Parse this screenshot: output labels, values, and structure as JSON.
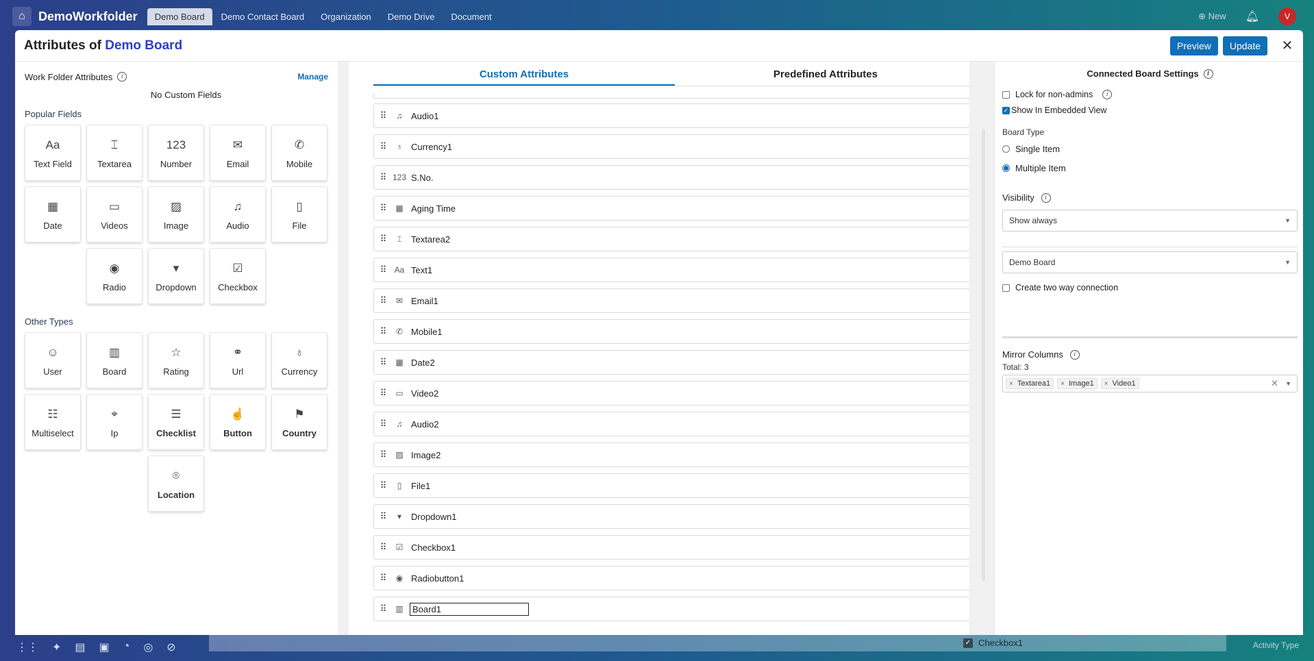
{
  "appbar": {
    "app_name": "DemoWorkfolder",
    "tabs": [
      "Demo Board",
      "Demo Contact Board",
      "Organization",
      "Demo Drive",
      "Document"
    ],
    "new_label": "New",
    "avatar": "V"
  },
  "modal": {
    "title_prefix": "Attributes of",
    "title_board": "Demo Board",
    "preview_label": "Preview",
    "update_label": "Update",
    "close_glyph": "✕"
  },
  "left": {
    "work_folder_title": "Work Folder Attributes",
    "manage_label": "Manage",
    "no_custom": "No Custom Fields",
    "popular_title": "Popular Fields",
    "popular": [
      {
        "label": "Text Field",
        "icon": "Aa"
      },
      {
        "label": "Textarea",
        "icon": "⌶"
      },
      {
        "label": "Number",
        "icon": "123"
      },
      {
        "label": "Email",
        "icon": "✉"
      },
      {
        "label": "Mobile",
        "icon": "✆"
      },
      {
        "label": "Date",
        "icon": "▦"
      },
      {
        "label": "Videos",
        "icon": "▭"
      },
      {
        "label": "Image",
        "icon": "▨"
      },
      {
        "label": "Audio",
        "icon": "♫"
      },
      {
        "label": "File",
        "icon": "▯"
      },
      {
        "label": "Radio",
        "icon": "◉"
      },
      {
        "label": "Dropdown",
        "icon": "▾"
      },
      {
        "label": "Checkbox",
        "icon": "☑"
      }
    ],
    "other_title": "Other Types",
    "other": [
      {
        "label": "User",
        "icon": "☺"
      },
      {
        "label": "Board",
        "icon": "▥"
      },
      {
        "label": "Rating",
        "icon": "☆"
      },
      {
        "label": "Url",
        "icon": "⚭"
      },
      {
        "label": "Currency",
        "icon": "♁"
      },
      {
        "label": "Multiselect",
        "icon": "☷"
      },
      {
        "label": "Ip",
        "icon": "⌖"
      },
      {
        "label": "Checklist",
        "icon": "☰"
      },
      {
        "label": "Button",
        "icon": "☝"
      },
      {
        "label": "Country",
        "icon": "⚑"
      },
      {
        "label": "Location",
        "icon": "⌾"
      }
    ]
  },
  "middle": {
    "tab_custom": "Custom Attributes",
    "tab_predefined": "Predefined Attributes",
    "items": [
      {
        "label": "Audio1",
        "icon": "♫"
      },
      {
        "label": "Currency1",
        "icon": "♁"
      },
      {
        "label": "S.No.",
        "icon": "123"
      },
      {
        "label": "Aging Time",
        "icon": "▦"
      },
      {
        "label": "Textarea2",
        "icon": "⌶"
      },
      {
        "label": "Text1",
        "icon": "Aa"
      },
      {
        "label": "Email1",
        "icon": "✉"
      },
      {
        "label": "Mobile1",
        "icon": "✆"
      },
      {
        "label": "Date2",
        "icon": "▦"
      },
      {
        "label": "Video2",
        "icon": "▭"
      },
      {
        "label": "Audio2",
        "icon": "♫"
      },
      {
        "label": "Image2",
        "icon": "▨"
      },
      {
        "label": "File1",
        "icon": "▯"
      },
      {
        "label": "Dropdown1",
        "icon": "▾"
      },
      {
        "label": "Checkbox1",
        "icon": "☑"
      },
      {
        "label": "Radiobutton1",
        "icon": "◉"
      },
      {
        "label": "Board1",
        "icon": "▥",
        "editing": true
      }
    ]
  },
  "right": {
    "title": "Connected Board Settings",
    "lock_label": "Lock for non-admins",
    "embedded_label": "Show In Embedded View",
    "board_type_label": "Board Type",
    "single_label": "Single Item",
    "multiple_label": "Multiple Item",
    "visibility_label": "Visibility",
    "visibility_value": "Show always",
    "board_select_value": "Demo Board",
    "two_way_label": "Create two way connection",
    "mirror_label": "Mirror Columns",
    "total_label": "Total: 3",
    "mirror_tags": [
      "Textarea1",
      "Image1",
      "Video1"
    ]
  },
  "bottom": {
    "checkbox_label": "Checkbox1",
    "activity_label": "Activity Type"
  },
  "colors": {
    "accent": "#0f6fb7",
    "title_board": "#2c3fc4"
  }
}
